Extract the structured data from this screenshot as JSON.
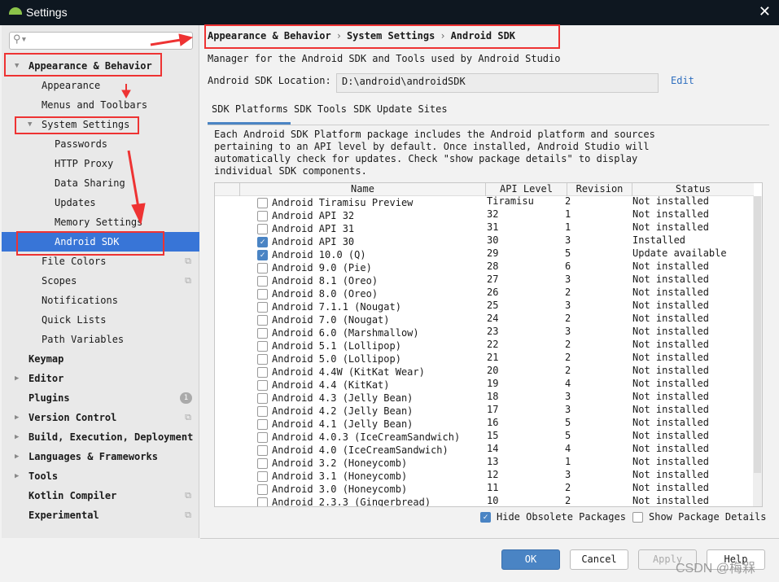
{
  "window": {
    "title": "Settings",
    "close": "✕"
  },
  "search": {
    "placeholder": "",
    "icon": "⚲▾"
  },
  "sidebar": {
    "items": [
      {
        "label": "Appearance & Behavior",
        "level": 0,
        "bold": true,
        "arrow": "down"
      },
      {
        "label": "Appearance",
        "level": 1
      },
      {
        "label": "Menus and Toolbars",
        "level": 1
      },
      {
        "label": "System Settings",
        "level": 1,
        "arrow": "down"
      },
      {
        "label": "Passwords",
        "level": 2
      },
      {
        "label": "HTTP Proxy",
        "level": 2
      },
      {
        "label": "Data Sharing",
        "level": 2
      },
      {
        "label": "Updates",
        "level": 2
      },
      {
        "label": "Memory Settings",
        "level": 2
      },
      {
        "label": "Android SDK",
        "level": 2,
        "selected": true
      },
      {
        "label": "File Colors",
        "level": 1,
        "copy": true
      },
      {
        "label": "Scopes",
        "level": 1,
        "copy": true
      },
      {
        "label": "Notifications",
        "level": 1
      },
      {
        "label": "Quick Lists",
        "level": 1
      },
      {
        "label": "Path Variables",
        "level": 1
      },
      {
        "label": "Keymap",
        "level": 0,
        "bold": true
      },
      {
        "label": "Editor",
        "level": 0,
        "bold": true,
        "arrow": "right"
      },
      {
        "label": "Plugins",
        "level": 0,
        "bold": true,
        "badge": "1"
      },
      {
        "label": "Version Control",
        "level": 0,
        "bold": true,
        "arrow": "right",
        "copy": true
      },
      {
        "label": "Build, Execution, Deployment",
        "level": 0,
        "bold": true,
        "arrow": "right"
      },
      {
        "label": "Languages & Frameworks",
        "level": 0,
        "bold": true,
        "arrow": "right"
      },
      {
        "label": "Tools",
        "level": 0,
        "bold": true,
        "arrow": "right"
      },
      {
        "label": "Kotlin Compiler",
        "level": 0,
        "bold": true,
        "copy": true
      },
      {
        "label": "Experimental",
        "level": 0,
        "bold": true,
        "copy": true
      }
    ]
  },
  "breadcrumb": [
    "Appearance & Behavior",
    "System Settings",
    "Android SDK"
  ],
  "breadcrumb_sep": "›",
  "main": {
    "description": "Manager for the Android SDK and Tools used by Android Studio",
    "location_label": "Android SDK Location:",
    "location_value": "D:\\android\\androidSDK",
    "edit_link": "Edit",
    "tabs": [
      "SDK Platforms",
      "SDK Tools",
      "SDK Update Sites"
    ],
    "paragraph": "Each Android SDK Platform package includes the Android platform and sources pertaining to an API level by default. Once installed, Android Studio will automatically check for updates. Check \"show package details\" to display individual SDK components.",
    "columns": [
      "Name",
      "API Level",
      "Revision",
      "Status"
    ],
    "rows": [
      [
        "Android Tiramisu Preview",
        "Tiramisu",
        "2",
        "Not installed",
        false
      ],
      [
        "Android API 32",
        "32",
        "1",
        "Not installed",
        false
      ],
      [
        "Android API 31",
        "31",
        "1",
        "Not installed",
        false
      ],
      [
        "Android API 30",
        "30",
        "3",
        "Installed",
        true
      ],
      [
        "Android 10.0 (Q)",
        "29",
        "5",
        "Update available",
        true
      ],
      [
        "Android 9.0 (Pie)",
        "28",
        "6",
        "Not installed",
        false
      ],
      [
        "Android 8.1 (Oreo)",
        "27",
        "3",
        "Not installed",
        false
      ],
      [
        "Android 8.0 (Oreo)",
        "26",
        "2",
        "Not installed",
        false
      ],
      [
        "Android 7.1.1 (Nougat)",
        "25",
        "3",
        "Not installed",
        false
      ],
      [
        "Android 7.0 (Nougat)",
        "24",
        "2",
        "Not installed",
        false
      ],
      [
        "Android 6.0 (Marshmallow)",
        "23",
        "3",
        "Not installed",
        false
      ],
      [
        "Android 5.1 (Lollipop)",
        "22",
        "2",
        "Not installed",
        false
      ],
      [
        "Android 5.0 (Lollipop)",
        "21",
        "2",
        "Not installed",
        false
      ],
      [
        "Android 4.4W (KitKat Wear)",
        "20",
        "2",
        "Not installed",
        false
      ],
      [
        "Android 4.4 (KitKat)",
        "19",
        "4",
        "Not installed",
        false
      ],
      [
        "Android 4.3 (Jelly Bean)",
        "18",
        "3",
        "Not installed",
        false
      ],
      [
        "Android 4.2 (Jelly Bean)",
        "17",
        "3",
        "Not installed",
        false
      ],
      [
        "Android 4.1 (Jelly Bean)",
        "16",
        "5",
        "Not installed",
        false
      ],
      [
        "Android 4.0.3 (IceCreamSandwich)",
        "15",
        "5",
        "Not installed",
        false
      ],
      [
        "Android 4.0 (IceCreamSandwich)",
        "14",
        "4",
        "Not installed",
        false
      ],
      [
        "Android 3.2 (Honeycomb)",
        "13",
        "1",
        "Not installed",
        false
      ],
      [
        "Android 3.1 (Honeycomb)",
        "12",
        "3",
        "Not installed",
        false
      ],
      [
        "Android 3.0 (Honeycomb)",
        "11",
        "2",
        "Not installed",
        false
      ],
      [
        "Android 2.3.3 (Gingerbread)",
        "10",
        "2",
        "Not installed",
        false
      ]
    ],
    "hide_obsolete": {
      "label": "Hide Obsolete Packages",
      "checked": true
    },
    "show_details": {
      "label": "Show Package Details",
      "checked": false
    }
  },
  "buttons": {
    "ok": "OK",
    "cancel": "Cancel",
    "apply": "Apply",
    "help": "Help"
  },
  "watermark": "CSDN @梅槑",
  "colors": {
    "accent": "#3875d7",
    "annotation": "#ee3333"
  }
}
